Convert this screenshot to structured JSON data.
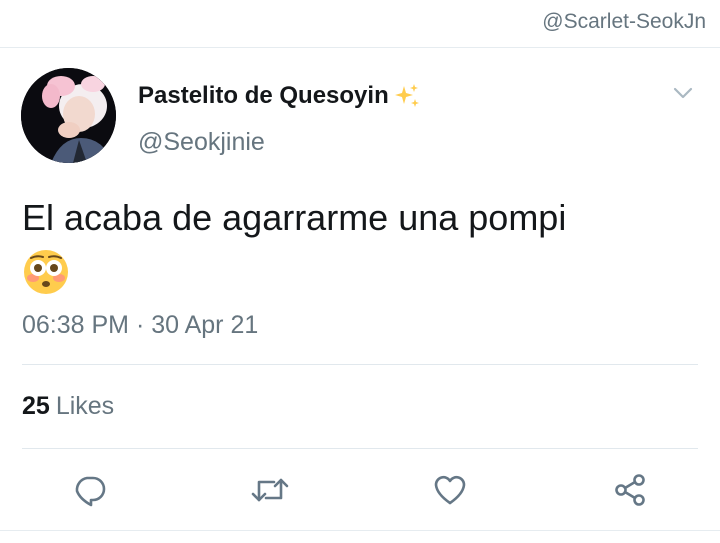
{
  "watermark": "@Scarlet-SeokJn",
  "author": {
    "display_name": "Pastelito de Quesoyin",
    "handle": "@Seokjinie",
    "name_emoji_icon": "sparkles-icon"
  },
  "tweet": {
    "text": "El acaba de agarrarme una pompi",
    "emoji_icon": "flushed-face-icon",
    "timestamp": "06:38 PM · 30 Apr 21"
  },
  "stats": {
    "likes_count": "25",
    "likes_label": "Likes"
  },
  "actions": {
    "icons": [
      "reply-icon",
      "retweet-icon",
      "like-icon",
      "share-icon"
    ],
    "icon_color": "#657786"
  },
  "colors": {
    "text_primary": "#14171a",
    "text_secondary": "#66757f",
    "divider": "#e1e8ed"
  }
}
